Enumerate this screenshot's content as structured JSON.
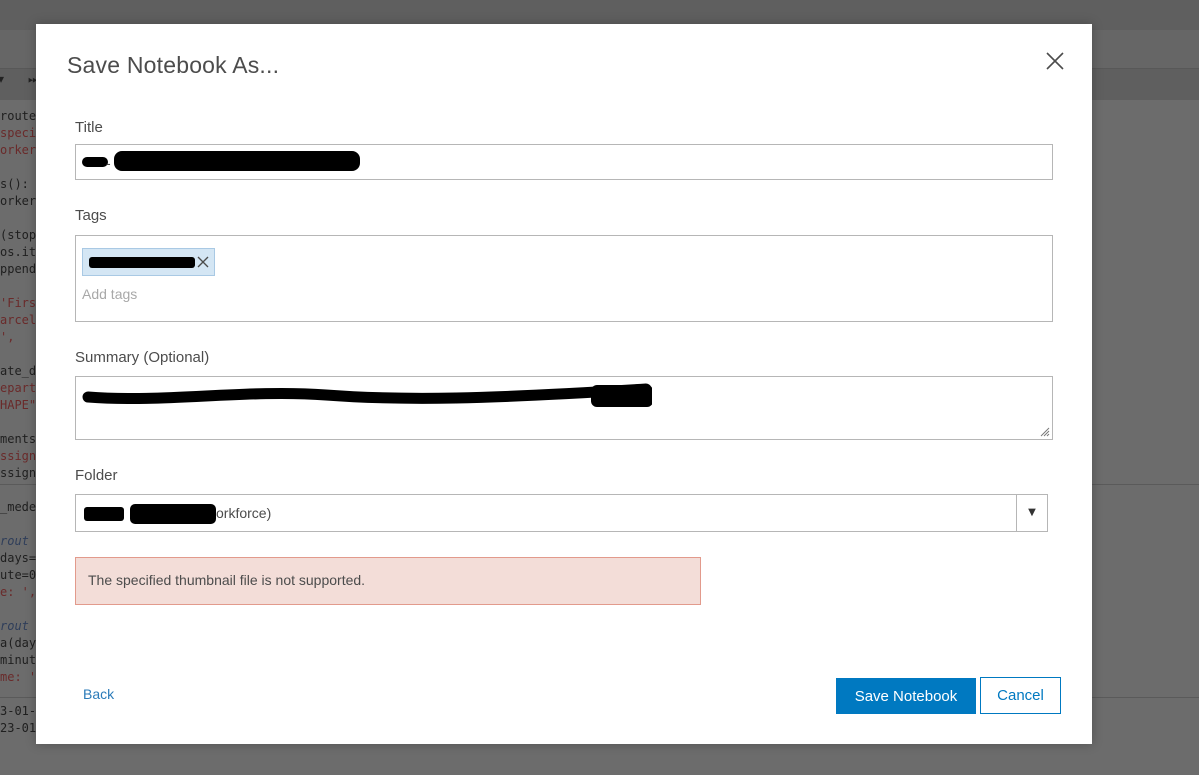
{
  "background": {
    "toolbar_icons": [
      "run-icon",
      "fast-forward-icon"
    ],
    "code_lines": [
      {
        "text": "route",
        "color": "dark"
      },
      {
        "text": "speci",
        "color": "red"
      },
      {
        "text": "orker",
        "color": "red"
      },
      {
        "text": "",
        "color": "dark"
      },
      {
        "text": "s():",
        "color": "dark"
      },
      {
        "text": "orker",
        "color": "dark"
      },
      {
        "text": "",
        "color": "dark"
      },
      {
        "text": "(stop",
        "color": "dark"
      },
      {
        "text": "os.it",
        "color": "dark"
      },
      {
        "text": "ppend",
        "color": "dark"
      },
      {
        "text": "",
        "color": "dark"
      },
      {
        "text": "'Firs",
        "color": "red"
      },
      {
        "text": "arcel",
        "color": "red"
      },
      {
        "text": "',",
        "color": "red"
      },
      {
        "text": "",
        "color": "dark"
      },
      {
        "text": "ate_d",
        "color": "dark"
      },
      {
        "text": "epart",
        "color": "red"
      },
      {
        "text": "HAPE\"",
        "color": "red"
      },
      {
        "text": "",
        "color": "dark"
      },
      {
        "text": "ments",
        "color": "dark"
      },
      {
        "text": "ssign",
        "color": "red"
      },
      {
        "text": "ssign",
        "color": "dark"
      },
      {
        "text": "",
        "color": "dark"
      },
      {
        "text": "_mede",
        "color": "dark"
      },
      {
        "text": "",
        "color": "dark"
      },
      {
        "text": " rout",
        "color": "blue"
      },
      {
        "text": "days=",
        "color": "dark"
      },
      {
        "text": "ute=0",
        "color": "dark"
      },
      {
        "text": "e: ',",
        "color": "red"
      },
      {
        "text": "",
        "color": "dark"
      },
      {
        "text": " rout",
        "color": "blue"
      },
      {
        "text": "a(day",
        "color": "dark"
      },
      {
        "text": "minut",
        "color": "dark"
      },
      {
        "text": "me: '",
        "color": "red"
      },
      {
        "text": "",
        "color": "dark"
      },
      {
        "text": "3-01-",
        "color": "dark"
      },
      {
        "text": "23-01",
        "color": "dark"
      }
    ]
  },
  "dialog": {
    "title": "Save Notebook As...",
    "close_icon": "close-icon",
    "title_field": {
      "label": "Title",
      "value": "-"
    },
    "tags_field": {
      "label": "Tags",
      "placeholder": "Add tags",
      "tags": [
        ""
      ]
    },
    "summary_field": {
      "label": "Summary (Optional)",
      "value": ""
    },
    "folder_field": {
      "label": "Folder",
      "value": "orkforce)",
      "arrow": "▼"
    },
    "alert": {
      "message": "The specified thumbnail file is not supported."
    },
    "back_label": "Back",
    "save_label": "Save Notebook",
    "cancel_label": "Cancel"
  },
  "colors": {
    "accent": "#0079c1",
    "alert_bg": "#f3ddd8",
    "alert_border": "#e29a8c",
    "tag_bg": "#d4e6f4",
    "overlay": "#6b6b6b"
  }
}
